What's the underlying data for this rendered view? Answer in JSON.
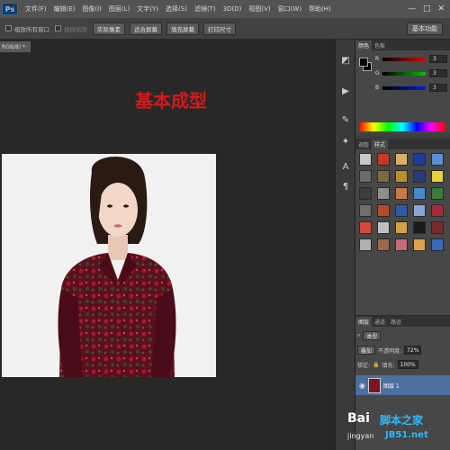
{
  "menubar": {
    "logo": "Ps",
    "items": [
      "文件(F)",
      "编辑(E)",
      "图像(I)",
      "图层(L)",
      "文字(Y)",
      "选择(S)",
      "滤镜(T)",
      "3D(D)",
      "视图(V)",
      "窗口(W)",
      "帮助(H)"
    ],
    "window_controls": [
      "—",
      "□",
      "✕"
    ]
  },
  "options_bar": {
    "resize_windows": "缩放所有窗口",
    "scrubby_zoom": "细微缩放",
    "buttons": [
      "实际像素",
      "适合屏幕",
      "填充屏幕",
      "打印尺寸"
    ],
    "workspace": "基本功能"
  },
  "document": {
    "tab_label": "RGB/8) *",
    "heading": "基本成型",
    "heading_color": "#d8181c"
  },
  "color_panel": {
    "tabs": [
      "颜色",
      "色板"
    ],
    "r_label": "R",
    "g_label": "G",
    "b_label": "B",
    "r_value": "3",
    "g_value": "3",
    "b_value": "3"
  },
  "styles_panel": {
    "tabs": [
      "调整",
      "样式"
    ],
    "swatches": [
      "#c9c9c9",
      "#c23a2a",
      "#d9b06a",
      "#1e3c9a",
      "#5a8fd0",
      "#6b6b6b",
      "#7a6a40",
      "#b8902a",
      "#2a3a7a",
      "#e6d23a",
      "#3d3d3d",
      "#8f8f8f",
      "#c57c48",
      "#4a88c8",
      "#3a7a3a",
      "#6e6e6e",
      "#b84a2a",
      "#2e5aa8",
      "#8aa4d8",
      "#a62a3a",
      "#d44a3a",
      "#c0c0c0",
      "#d0a24a",
      "#1a1a1a",
      "#7a2a2a",
      "#b0b0b0",
      "#9a6a4a",
      "#c46a7a",
      "#e0a24a",
      "#3a6ab8"
    ]
  },
  "layers_panel": {
    "tabs": [
      "图层",
      "通道",
      "路径"
    ],
    "kind_label": "类型",
    "blend_mode": "叠加",
    "opacity_label": "不透明度:",
    "opacity_value": "72%",
    "lock_label": "锁定:",
    "fill_label": "填充:",
    "fill_value": "100%",
    "layer_name": "图层 1"
  },
  "watermark": {
    "baidu": "Bai",
    "jingyan": "jingyan",
    "site": "脚本之家",
    "url": "JB51.net"
  }
}
